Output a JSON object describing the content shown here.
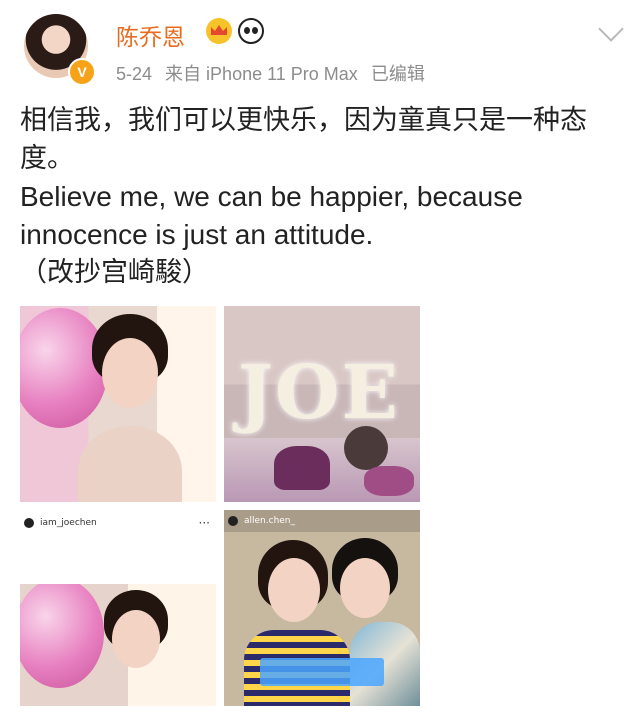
{
  "user": {
    "name": "陈乔恩",
    "date": "5-24",
    "source": "来自 iPhone 11 Pro Max",
    "edited": "已编辑",
    "verify_mark": "V"
  },
  "post": {
    "line1": "相信我，我们可以更快乐，因为童真只是一种态度。",
    "line2": "Believe me, we can be happier, because innocence is just an attitude.",
    "line3": "（改抄宫崎駿）"
  },
  "images": {
    "img2_sign": "JOE",
    "img3_user": "iam_joechen",
    "img3_more": "···",
    "img4_user": "allen.chen_"
  },
  "icons": {
    "crown": "crown-badge-icon",
    "panda": "panda-badge-icon",
    "menu": "chevron-down-icon"
  },
  "colors": {
    "name": "#e86b1f",
    "meta": "#8c8c8c"
  }
}
